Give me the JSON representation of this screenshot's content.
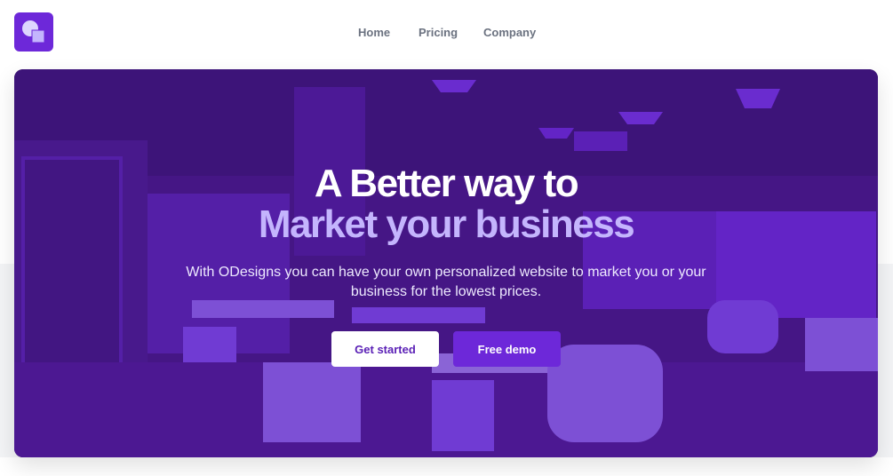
{
  "header": {
    "logo_icon": "shapes-logo-icon",
    "nav": [
      {
        "label": "Home"
      },
      {
        "label": "Pricing"
      },
      {
        "label": "Company"
      }
    ]
  },
  "hero": {
    "background": "office-photo",
    "title_line1": "A Better way to",
    "title_line2": "Market your business",
    "subtitle": "With ODesigns you can have your own personalized website to market you or your business for the lowest prices.",
    "primary_button": "Get started",
    "secondary_button": "Free demo"
  },
  "colors": {
    "brand": "#6d28d9",
    "accent_text": "#c4b5fd",
    "nav_text": "#6b7280"
  }
}
